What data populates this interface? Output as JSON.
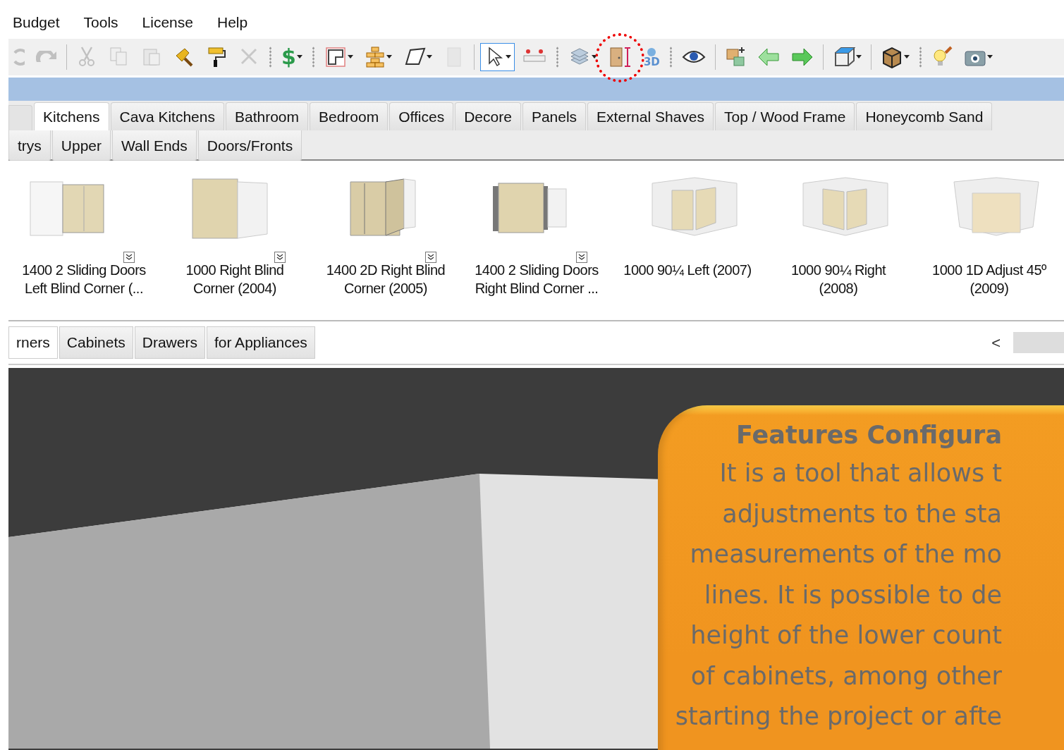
{
  "menu": [
    "Budget",
    "Tools",
    "License",
    "Help"
  ],
  "toolbar": [
    {
      "kind": "button",
      "dropdown": false,
      "disabled": true,
      "selected": false,
      "circled": false
    },
    {
      "kind": "button",
      "dropdown": false,
      "disabled": true,
      "selected": false,
      "circled": false
    },
    {
      "kind": "separator"
    },
    {
      "kind": "button",
      "dropdown": false,
      "disabled": true,
      "selected": false,
      "circled": false
    },
    {
      "kind": "button",
      "dropdown": false,
      "disabled": true,
      "selected": false,
      "circled": false
    },
    {
      "kind": "button",
      "dropdown": false,
      "disabled": true,
      "selected": false,
      "circled": false
    },
    {
      "kind": "button",
      "dropdown": false,
      "disabled": false,
      "selected": false,
      "circled": false
    },
    {
      "kind": "button",
      "dropdown": false,
      "disabled": false,
      "selected": false,
      "circled": false
    },
    {
      "kind": "button",
      "dropdown": false,
      "disabled": true,
      "selected": false,
      "circled": false
    },
    {
      "kind": "grip"
    },
    {
      "kind": "button",
      "dropdown": true,
      "disabled": false,
      "selected": false,
      "circled": false,
      "label": "$"
    },
    {
      "kind": "grip"
    },
    {
      "kind": "button",
      "dropdown": true,
      "disabled": false,
      "selected": false,
      "circled": false
    },
    {
      "kind": "button",
      "dropdown": true,
      "disabled": false,
      "selected": false,
      "circled": false
    },
    {
      "kind": "button",
      "dropdown": true,
      "disabled": false,
      "selected": false,
      "circled": false
    },
    {
      "kind": "button",
      "dropdown": false,
      "disabled": true,
      "selected": false,
      "circled": false
    },
    {
      "kind": "separator"
    },
    {
      "kind": "button",
      "dropdown": true,
      "disabled": false,
      "selected": true,
      "circled": false
    },
    {
      "kind": "button",
      "dropdown": false,
      "disabled": false,
      "selected": false,
      "circled": false
    },
    {
      "kind": "grip"
    },
    {
      "kind": "button",
      "dropdown": true,
      "disabled": false,
      "selected": false,
      "circled": false
    },
    {
      "kind": "button",
      "dropdown": false,
      "disabled": false,
      "selected": false,
      "circled": true
    },
    {
      "kind": "button",
      "dropdown": false,
      "disabled": false,
      "selected": false,
      "circled": false,
      "label": "3D"
    },
    {
      "kind": "grip"
    },
    {
      "kind": "button",
      "dropdown": false,
      "disabled": false,
      "selected": false,
      "circled": false
    },
    {
      "kind": "separator"
    },
    {
      "kind": "button",
      "dropdown": false,
      "disabled": false,
      "selected": false,
      "circled": false
    },
    {
      "kind": "button",
      "dropdown": false,
      "disabled": false,
      "selected": false,
      "circled": false
    },
    {
      "kind": "button",
      "dropdown": false,
      "disabled": false,
      "selected": false,
      "circled": false
    },
    {
      "kind": "separator"
    },
    {
      "kind": "button",
      "dropdown": true,
      "disabled": false,
      "selected": false,
      "circled": false
    },
    {
      "kind": "separator"
    },
    {
      "kind": "button",
      "dropdown": true,
      "disabled": false,
      "selected": false,
      "circled": false
    },
    {
      "kind": "grip"
    },
    {
      "kind": "button",
      "dropdown": false,
      "disabled": false,
      "selected": false,
      "circled": false
    },
    {
      "kind": "button",
      "dropdown": true,
      "disabled": false,
      "selected": false,
      "circled": false
    }
  ],
  "category_tabs": [
    {
      "label": "Kitchens",
      "selected": true
    },
    {
      "label": "Cava Kitchens",
      "selected": false
    },
    {
      "label": "Bathroom",
      "selected": false
    },
    {
      "label": "Bedroom",
      "selected": false
    },
    {
      "label": "Offices",
      "selected": false
    },
    {
      "label": "Decore",
      "selected": false
    },
    {
      "label": "Panels",
      "selected": false
    },
    {
      "label": "External Shaves",
      "selected": false
    },
    {
      "label": "Top / Wood Frame",
      "selected": false
    },
    {
      "label": "Honeycomb Sand",
      "selected": false
    }
  ],
  "subcategory_tabs": [
    {
      "label": "trys",
      "selected": false
    },
    {
      "label": "Upper",
      "selected": false
    },
    {
      "label": "Wall Ends",
      "selected": false
    },
    {
      "label": "Doors/Fronts",
      "selected": false
    }
  ],
  "gallery": [
    {
      "label": "1400 2 Sliding Doors\nLeft Blind Corner (...",
      "expandable": true
    },
    {
      "label": "1000 Right Blind\nCorner (2004)",
      "expandable": true
    },
    {
      "label": "1400 2D Right Blind\nCorner (2005)",
      "expandable": true
    },
    {
      "label": "1400 2 Sliding Doors\nRight Blind Corner ...",
      "expandable": true
    },
    {
      "label": "1000 90¼ Left (2007)",
      "expandable": false
    },
    {
      "label": "1000 90¼ Right\n(2008)",
      "expandable": false
    },
    {
      "label": "1000 1D Adjust 45º\n(2009)",
      "expandable": false
    }
  ],
  "group_tabs": [
    {
      "label": "rners",
      "selected": true
    },
    {
      "label": "Cabinets",
      "selected": false
    },
    {
      "label": "Drawers",
      "selected": false
    },
    {
      "label": "for Appliances",
      "selected": false
    }
  ],
  "scroll_left": "<",
  "callout": {
    "title": "Features Configura",
    "lines": [
      "It is a tool that allows t",
      "adjustments to the sta",
      "measurements of the mo",
      "lines. It is possible to de",
      "height of the lower count",
      "of cabinets, among other",
      "starting the project or afte"
    ]
  }
}
